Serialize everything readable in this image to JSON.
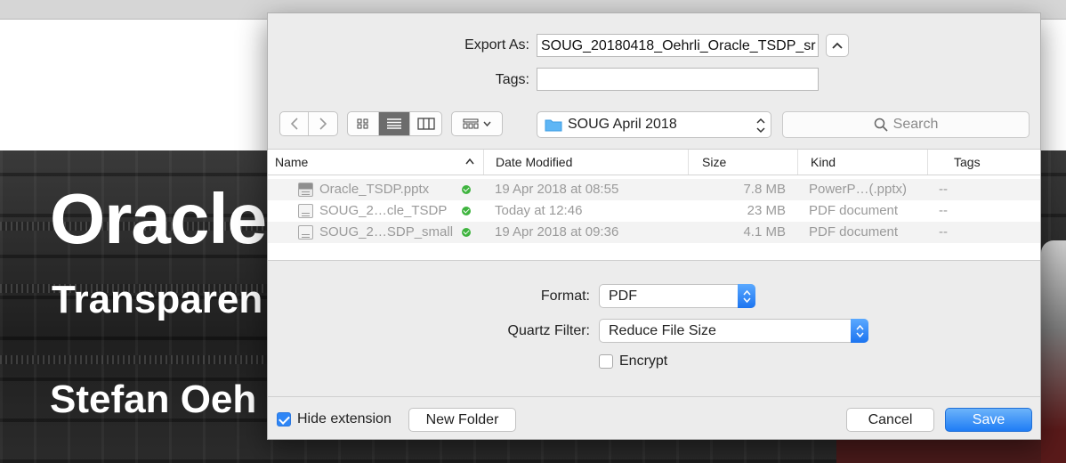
{
  "background": {
    "slide_title": "Oracle",
    "slide_subtitle": "Transparen",
    "slide_author": "Stefan Oeh"
  },
  "dialog": {
    "export_as_label": "Export As:",
    "export_as_value": "SOUG_20180418_Oehrli_Oracle_TSDP_sr",
    "tags_label": "Tags:",
    "tags_value": "",
    "location": "SOUG April 2018",
    "search_placeholder": "Search",
    "columns": {
      "name": "Name",
      "date_modified": "Date Modified",
      "size": "Size",
      "kind": "Kind",
      "tags": "Tags"
    },
    "files": [
      {
        "name": "Oracle_TSDP.pptx",
        "date": "19 Apr 2018 at 08:55",
        "size": "7.8 MB",
        "kind": "PowerP…(.pptx)",
        "tags": "--",
        "icon": "pptx-file-icon"
      },
      {
        "name": "SOUG_2…cle_TSDP",
        "date": "Today at 12:46",
        "size": "23 MB",
        "kind": "PDF document",
        "tags": "--",
        "icon": "pdf-file-icon"
      },
      {
        "name": "SOUG_2…SDP_small",
        "date": "19 Apr 2018 at 09:36",
        "size": "4.1 MB",
        "kind": "PDF document",
        "tags": "--",
        "icon": "pdf-file-icon"
      }
    ],
    "format_label": "Format:",
    "format_value": "PDF",
    "quartz_label": "Quartz Filter:",
    "quartz_value": "Reduce File Size",
    "encrypt_label": "Encrypt",
    "encrypt_checked": false,
    "hide_extension_label": "Hide extension",
    "hide_extension_checked": true,
    "new_folder_label": "New Folder",
    "cancel_label": "Cancel",
    "save_label": "Save"
  },
  "colors": {
    "accent": "#1f7df5",
    "sync_ok": "#3fb43f",
    "folder": "#5fb6f5"
  }
}
